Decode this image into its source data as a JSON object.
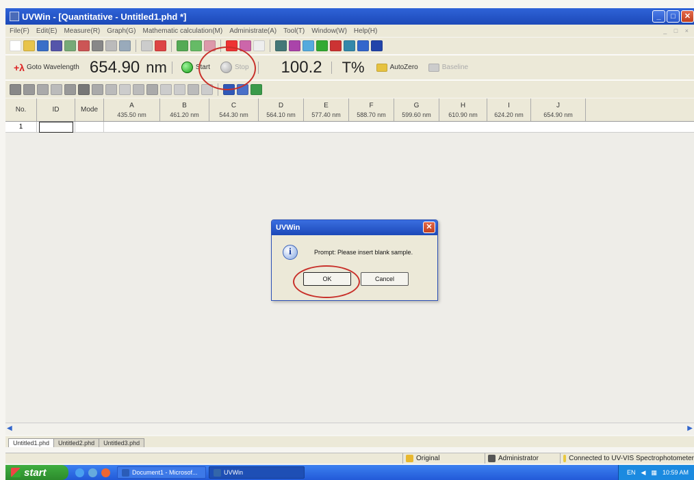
{
  "window": {
    "title": "UVWin - [Quantitative - Untitled1.phd *]",
    "controls": [
      "_",
      "□",
      "✕"
    ]
  },
  "menu": [
    "File(F)",
    "Edit(E)",
    "Measure(R)",
    "Graph(G)",
    "Mathematic calculation(M)",
    "Administrate(A)",
    "Tool(T)",
    "Window(W)",
    "Help(H)"
  ],
  "toolbar": {
    "goto_label": "Goto Wavelength",
    "wavelength": "654.90",
    "wavelength_unit": "nm",
    "start_label": "Start",
    "stop_label": "Stop",
    "reading": "100.2",
    "reading_unit": "T%",
    "autozero_label": "AutoZero",
    "baseline_label": "Baseline"
  },
  "table": {
    "fixed_headers": [
      "No.",
      "ID",
      "Mode"
    ],
    "columns": [
      {
        "letter": "A",
        "wavelength": "435.50 nm"
      },
      {
        "letter": "B",
        "wavelength": "461.20 nm"
      },
      {
        "letter": "C",
        "wavelength": "544.30 nm"
      },
      {
        "letter": "D",
        "wavelength": "564.10 nm"
      },
      {
        "letter": "E",
        "wavelength": "577.40 nm"
      },
      {
        "letter": "F",
        "wavelength": "588.70 nm"
      },
      {
        "letter": "G",
        "wavelength": "599.60 nm"
      },
      {
        "letter": "H",
        "wavelength": "610.90 nm"
      },
      {
        "letter": "I",
        "wavelength": "624.20 nm"
      },
      {
        "letter": "J",
        "wavelength": "654.90 nm"
      }
    ],
    "rows": [
      {
        "no": "1"
      }
    ]
  },
  "dialog": {
    "title": "UVWin",
    "message": "Prompt: Please insert blank sample.",
    "ok_label": "OK",
    "cancel_label": "Cancel",
    "icon": "information-icon"
  },
  "sheet_tabs": [
    "Untitled1.phd",
    "Untitled2.phd",
    "Untitled3.phd"
  ],
  "statusbar": {
    "original": "Original",
    "user": "Administrator",
    "connection": "Connected to UV-VIS Spectrophotometer"
  },
  "taskbar": {
    "start_label": "start",
    "tasks": [
      "Document1 - Microsof...",
      "UVWin"
    ],
    "lang": "EN",
    "time": "10:59 AM"
  },
  "colors": {
    "titlebar": "#1c49b8",
    "annotation": "#c8302a",
    "start_led": "#1aa21a"
  }
}
